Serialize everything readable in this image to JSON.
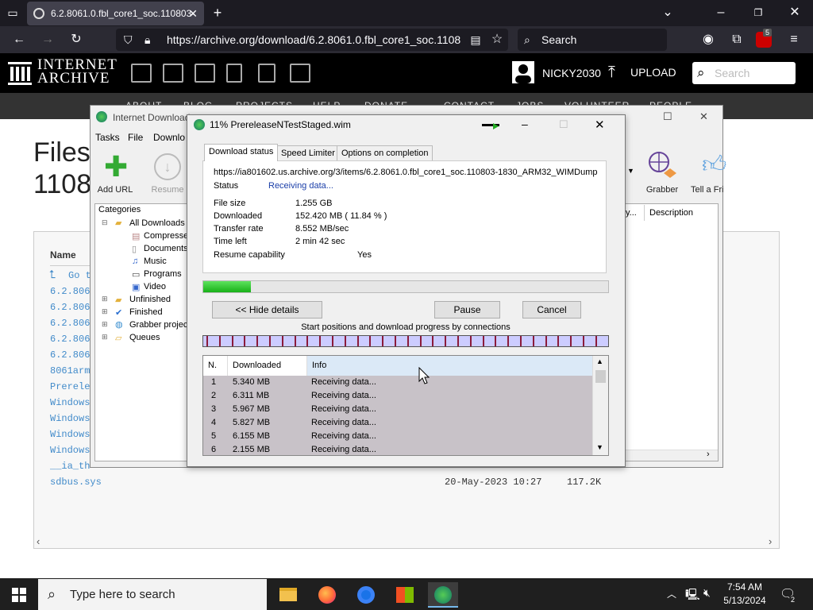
{
  "browser": {
    "tab_title": "6.2.8061.0.fbl_core1_soc.110803-",
    "url": "https://archive.org/download/6.2.8061.0.fbl_core1_soc.1108",
    "search_placeholder": "Search",
    "extension_badge": "5"
  },
  "archive": {
    "logo_line1": "INTERNET",
    "logo_line2": "ARCHIVE",
    "username": "NICKY2030",
    "upload_label": "UPLOAD",
    "search_placeholder": "Search",
    "subnav": [
      "ABOUT",
      "BLOG",
      "PROJECTS",
      "HELP",
      "DONATE",
      "CONTACT",
      "JOBS",
      "VOLUNTEER",
      "PEOPLE"
    ]
  },
  "page": {
    "title_line1": "Files",
    "title_line2": "1108",
    "name_header": "Name",
    "rows": [
      "Go t",
      "6.2.806",
      "6.2.806",
      "6.2.806",
      "6.2.806",
      "6.2.806",
      "8061arm",
      "Prerele",
      "Windows",
      "Windows",
      "Windows",
      "Windows",
      "__ia_th",
      "sdbus.sys"
    ],
    "last_row_date": "20-May-2023 10:27",
    "last_row_size": "117.2K"
  },
  "idm": {
    "title": "Internet Download",
    "menu": [
      "Tasks",
      "File",
      "Downlo"
    ],
    "toolbar": {
      "add_url": "Add URL",
      "resume": "Resume",
      "grabber": "Grabber",
      "tell": "Tell a Fri"
    },
    "categories_label": "Categories",
    "categories": [
      "All Downloads",
      "Compresse",
      "Documents",
      "Music",
      "Programs",
      "Video",
      "Unfinished",
      "Finished",
      "Grabber projec",
      "Queues"
    ],
    "list_headers": {
      "size": "y...",
      "description": "Description"
    }
  },
  "dialog": {
    "title": "11% PrereleaseNTestStaged.wim",
    "tabs": [
      "Download status",
      "Speed Limiter",
      "Options on completion"
    ],
    "url": "https://ia801602.us.archive.org/3/items/6.2.8061.0.fbl_core1_soc.110803-1830_ARM32_WIMDump",
    "status_label": "Status",
    "status_value": "Receiving data...",
    "file_size_label": "File size",
    "file_size_value": "1.255  GB",
    "downloaded_label": "Downloaded",
    "downloaded_value": "152.420  MB  ( 11.84 % )",
    "transfer_label": "Transfer rate",
    "transfer_value": "8.552  MB/sec",
    "time_left_label": "Time left",
    "time_left_value": "2 min 42 sec",
    "resume_label": "Resume capability",
    "resume_value": "Yes",
    "progress": 0.1184,
    "hide_details": "<< Hide details",
    "pause": "Pause",
    "cancel": "Cancel",
    "connections_caption": "Start positions and download progress by connections",
    "table_headers": {
      "n": "N.",
      "downloaded": "Downloaded",
      "info": "Info"
    },
    "connections": [
      {
        "n": "1",
        "downloaded": "5.340  MB",
        "info": "Receiving data..."
      },
      {
        "n": "2",
        "downloaded": "6.311  MB",
        "info": "Receiving data..."
      },
      {
        "n": "3",
        "downloaded": "5.967  MB",
        "info": "Receiving data..."
      },
      {
        "n": "4",
        "downloaded": "5.827  MB",
        "info": "Receiving data..."
      },
      {
        "n": "5",
        "downloaded": "6.155  MB",
        "info": "Receiving data..."
      },
      {
        "n": "6",
        "downloaded": "2.155  MB",
        "info": "Receiving data..."
      }
    ]
  },
  "taskbar": {
    "search_placeholder": "Type here to search",
    "time": "7:54 AM",
    "date": "5/13/2024",
    "notification_count": "2"
  }
}
